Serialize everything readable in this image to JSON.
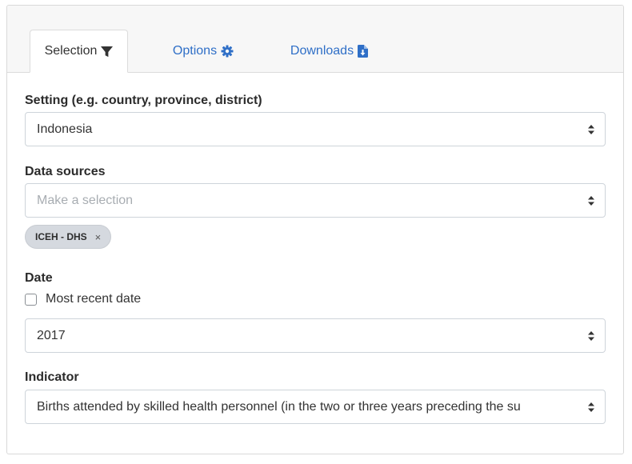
{
  "tabs": [
    {
      "label": "Selection",
      "icon": "filter-icon",
      "active": true
    },
    {
      "label": "Options",
      "icon": "gear-icon",
      "active": false
    },
    {
      "label": "Downloads",
      "icon": "file-download-icon",
      "active": false
    }
  ],
  "setting": {
    "label": "Setting (e.g. country, province, district)",
    "value": "Indonesia"
  },
  "data_sources": {
    "label": "Data sources",
    "placeholder": "Make a selection",
    "selected_tags": [
      "ICEH - DHS"
    ],
    "remove_symbol": "×"
  },
  "date": {
    "label": "Date",
    "checkbox_label": "Most recent date",
    "checked": false,
    "value": "2017"
  },
  "indicator": {
    "label": "Indicator",
    "value": "Births attended by skilled health personnel (in the two or three years preceding the su"
  },
  "colors": {
    "link": "#2f6fc7",
    "tag_bg": "#d5d9df",
    "header_bg": "#f7f7f7"
  }
}
